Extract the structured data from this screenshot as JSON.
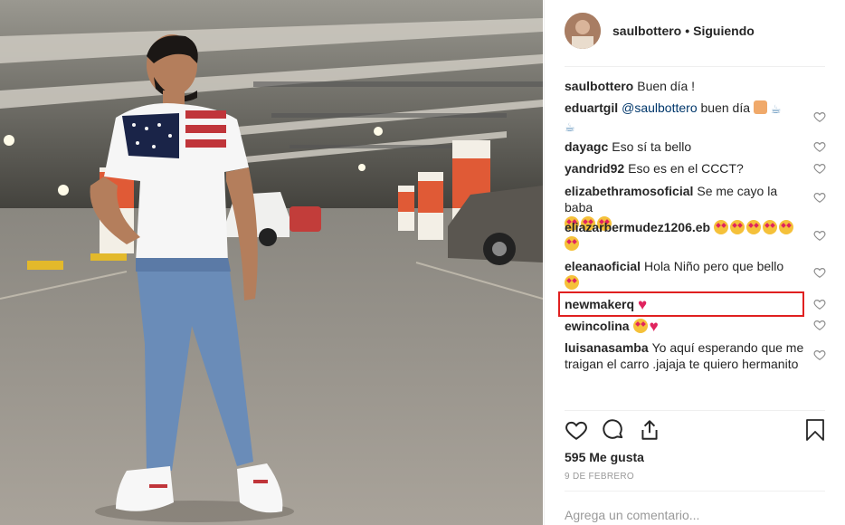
{
  "post": {
    "photo_alt": "",
    "username": "saulbottero",
    "separator": "•",
    "follow_status": "Siguiendo",
    "likes": "595 Me gusta",
    "date": "9 DE FEBRERO",
    "add_comment_placeholder": "Agrega un comentario..."
  },
  "comments": [
    {
      "user": "saulbottero",
      "text": "Buen día !"
    },
    {
      "user": "eduartgil",
      "mention": "@saulbottero",
      "text": "buen día"
    },
    {
      "user": "dayagc",
      "text": "Eso sí ta bello"
    },
    {
      "user": "yandrid92",
      "text": "Eso es en el CCCT?"
    },
    {
      "user": "elizabethramosoficial",
      "text": "Se me cayo la baba"
    },
    {
      "user": "eliazarbermudez1206.eb",
      "text": ""
    },
    {
      "user": "eleanaoficial",
      "text": "Hola Niño pero que bello"
    },
    {
      "user": "newmakerq",
      "text": ""
    },
    {
      "user": "ewincolina",
      "text": ""
    },
    {
      "user": "luisanasamba",
      "text": "Yo aquí esperando que me traigan el carro .jajaja te quiero hermanito"
    }
  ],
  "colors": {
    "highlight": "#e02020",
    "heart": "#e0245e",
    "link": "#00376b"
  }
}
